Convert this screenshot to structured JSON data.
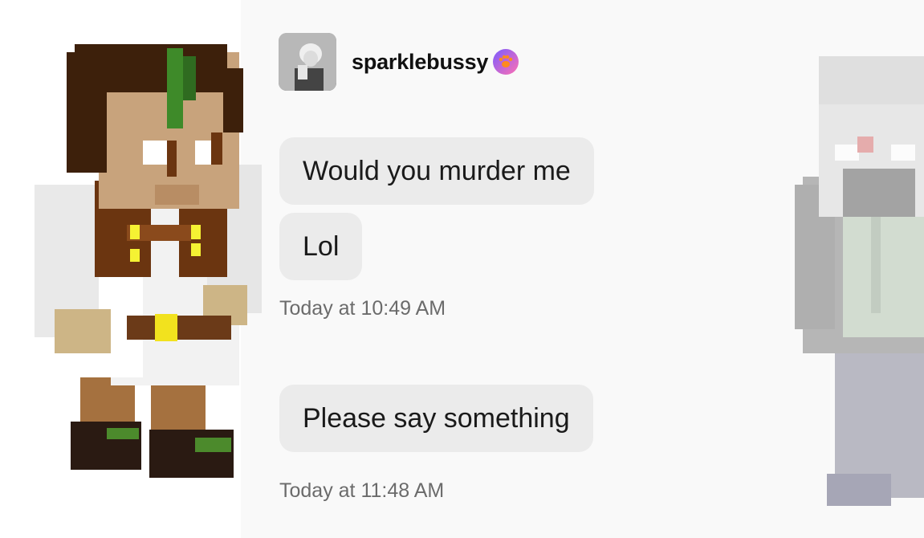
{
  "conversation": {
    "username": "sparklebussy",
    "avatar_icon": "profile-photo",
    "badge_icon": "paw-badge-icon",
    "messages": [
      {
        "text": "Would you murder me"
      },
      {
        "text": "Lol"
      },
      {
        "timestamp": "Today at 10:49 AM"
      },
      {
        "text": "Please say something"
      },
      {
        "timestamp": "Today at 11:48 AM"
      }
    ]
  },
  "decorations": {
    "left_character": "minecraft-skin-brown-hair-green-streak",
    "right_character": "minecraft-skin-gray-faded"
  }
}
